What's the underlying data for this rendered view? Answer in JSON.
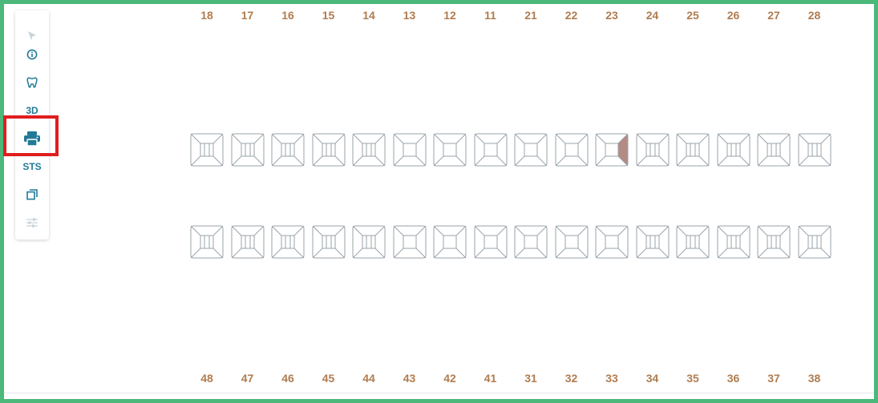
{
  "toolbar": {
    "items": [
      {
        "icon": "cursor-icon",
        "label": "",
        "disabled": true
      },
      {
        "icon": "info-icon",
        "label": "",
        "disabled": false
      },
      {
        "icon": "tooth-icon",
        "label": "",
        "disabled": false
      },
      {
        "icon": "3d-icon",
        "label": "3D",
        "disabled": false
      },
      {
        "icon": "print-icon",
        "label": "",
        "disabled": false
      },
      {
        "icon": "sts-icon",
        "label": "STS",
        "disabled": false
      },
      {
        "icon": "copy-icon",
        "label": "",
        "disabled": false
      },
      {
        "icon": "sliders-icon",
        "label": "",
        "disabled": true
      }
    ]
  },
  "chart": {
    "upper_numbers": [
      "18",
      "17",
      "16",
      "15",
      "14",
      "13",
      "12",
      "11",
      "21",
      "22",
      "23",
      "24",
      "25",
      "26",
      "27",
      "28"
    ],
    "lower_numbers": [
      "48",
      "47",
      "46",
      "45",
      "44",
      "43",
      "42",
      "41",
      "31",
      "32",
      "33",
      "34",
      "35",
      "36",
      "37",
      "38"
    ],
    "upper_teeth": [
      "18",
      "17",
      "16",
      "15",
      "14",
      "13",
      "12",
      "11",
      "21",
      "22",
      "23",
      "24",
      "25",
      "26",
      "27",
      "28"
    ],
    "lower_teeth": [
      "48",
      "47",
      "46",
      "45",
      "44",
      "43",
      "42",
      "41",
      "31",
      "32",
      "33",
      "34",
      "35",
      "36",
      "37",
      "38"
    ],
    "marked": [
      {
        "tooth": "23",
        "surface": "right"
      }
    ]
  },
  "colors": {
    "tooth_stroke": "#9aa3aa",
    "marked_fill": "#b48a84",
    "number": "#b07c50",
    "accent": "#217a96",
    "highlight": "#e01e1e",
    "frame": "#4cb87a"
  }
}
